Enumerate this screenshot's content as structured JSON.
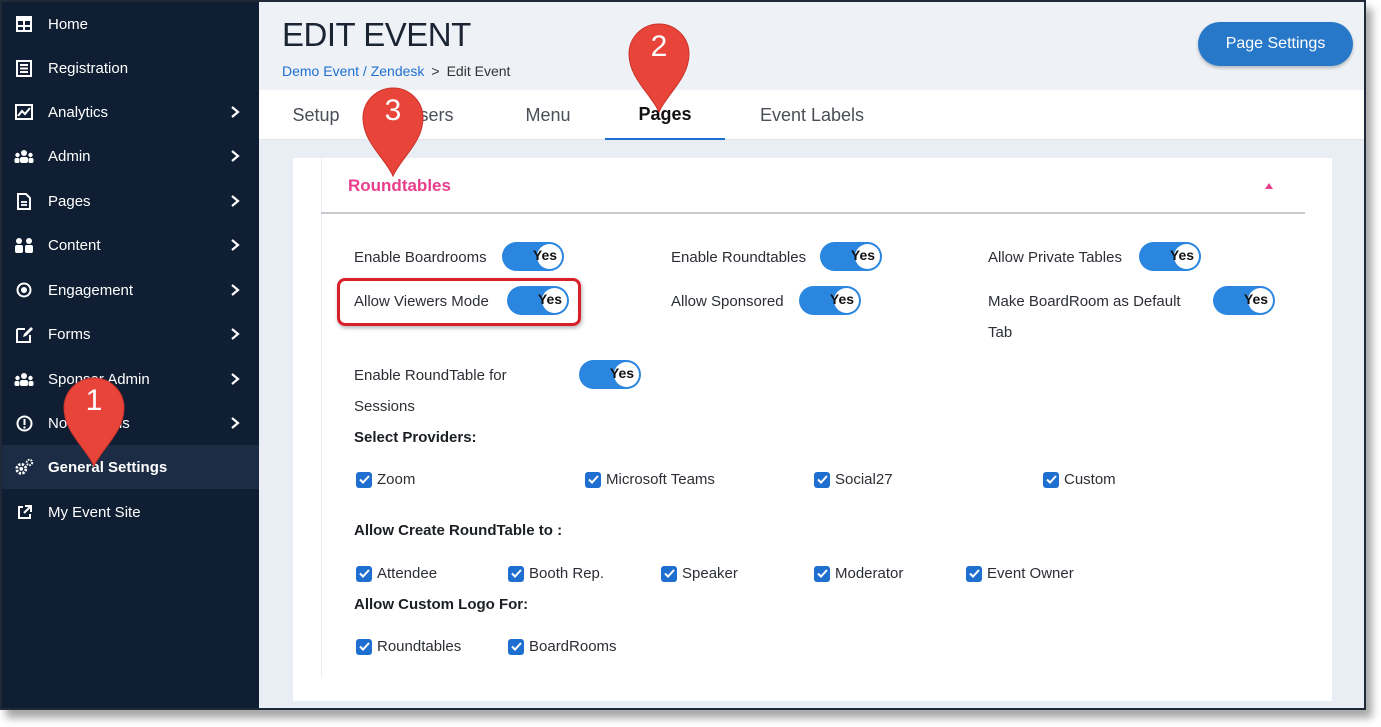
{
  "sidebar": {
    "items": [
      {
        "label": "Home",
        "icon": "home-grid-icon",
        "chevron": false
      },
      {
        "label": "Registration",
        "icon": "registration-list-icon",
        "chevron": false
      },
      {
        "label": "Analytics",
        "icon": "analytics-chart-icon",
        "chevron": true
      },
      {
        "label": "Admin",
        "icon": "admin-users-icon",
        "chevron": true
      },
      {
        "label": "Pages",
        "icon": "pages-document-icon",
        "chevron": true
      },
      {
        "label": "Content",
        "icon": "content-people-icon",
        "chevron": true
      },
      {
        "label": "Engagement",
        "icon": "engagement-target-icon",
        "chevron": true
      },
      {
        "label": "Forms",
        "icon": "forms-edit-icon",
        "chevron": true
      },
      {
        "label": "Sponsor Admin",
        "icon": "sponsor-users-icon",
        "chevron": true
      },
      {
        "label": "Notifications",
        "icon": "notification-alert-icon",
        "chevron": true
      },
      {
        "label": "General Settings",
        "icon": "settings-gears-icon",
        "chevron": false,
        "active": true
      },
      {
        "label": "My Event Site",
        "icon": "external-link-icon",
        "chevron": false
      }
    ]
  },
  "header": {
    "title": "EDIT EVENT",
    "breadcrumb_link": "Demo Event / Zendesk",
    "breadcrumb_sep": ">",
    "breadcrumb_current": "Edit Event",
    "page_settings_label": "Page Settings"
  },
  "tabs": [
    {
      "label": "Setup"
    },
    {
      "label": "Users"
    },
    {
      "label": "Menu"
    },
    {
      "label": "Pages",
      "active": true
    },
    {
      "label": "Event Labels"
    }
  ],
  "section": {
    "title": "Roundtables",
    "toggles": [
      {
        "label": "Enable Boardrooms",
        "value": "Yes"
      },
      {
        "label": "Enable Roundtables",
        "value": "Yes"
      },
      {
        "label": "Allow Private Tables",
        "value": "Yes"
      },
      {
        "label": "Allow Viewers Mode",
        "value": "Yes"
      },
      {
        "label": "Allow Sponsored",
        "value": "Yes"
      },
      {
        "label_line1": "Make BoardRoom as Default",
        "label_line2": "Tab",
        "value": "Yes"
      },
      {
        "label_line1": "Enable RoundTable for",
        "label_line2": "Sessions",
        "value": "Yes"
      }
    ],
    "providers_heading": "Select Providers:",
    "providers": [
      "Zoom",
      "Microsoft Teams",
      "Social27",
      "Custom"
    ],
    "create_heading": "Allow Create RoundTable to :",
    "create_roles": [
      "Attendee",
      "Booth Rep.",
      "Speaker",
      "Moderator",
      "Event Owner"
    ],
    "logo_heading": "Allow Custom Logo For:",
    "logo_items": [
      "Roundtables",
      "BoardRooms"
    ]
  },
  "callouts": [
    "1",
    "2",
    "3"
  ],
  "colors": {
    "sidebar_bg": "#0f1e33",
    "accent": "#2b86e0",
    "section_title": "#e83e8c",
    "callout": "#e8443a",
    "highlight": "#d9202a"
  }
}
